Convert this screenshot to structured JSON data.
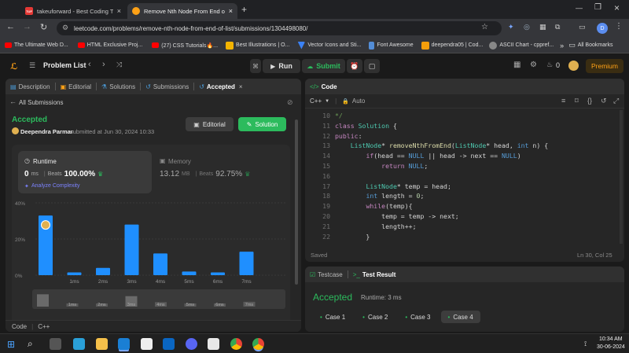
{
  "browser": {
    "tabs": [
      {
        "title": "takeuforward - Best Coding Tut",
        "favicon_color": "#e53935",
        "favicon_text": "TUF"
      },
      {
        "title": "Remove Nth Node From End of",
        "favicon_color": "#ffa116",
        "favicon_text": ""
      }
    ],
    "url": "leetcode.com/problems/remove-nth-node-from-end-of-list/submissions/1304498080/",
    "bookmarks": [
      {
        "label": "The Ultimate Web D...",
        "color": "#ff0000"
      },
      {
        "label": "HTML Exclusive Proj...",
        "color": "#ff0000"
      },
      {
        "label": "(27) CSS Tutorials🔥...",
        "color": "#ff0000"
      },
      {
        "label": "Best Illustrations | O...",
        "color": "#f4b400"
      },
      {
        "label": "Vector Icons and Sti...",
        "color": "#3b82f6"
      },
      {
        "label": "Font Awesome",
        "color": "#538dd7"
      },
      {
        "label": "deependra05 | Cod...",
        "color": "#f59e0b"
      },
      {
        "label": "ASCII Chart - cppref...",
        "color": "#888888"
      }
    ],
    "all_bookmarks": "All Bookmarks",
    "profile_initial": "D"
  },
  "nav": {
    "problem_list": "Problem List",
    "run": "Run",
    "submit": "Submit",
    "streak": "0",
    "premium": "Premium"
  },
  "left": {
    "tabs": {
      "description": "Description",
      "editorial": "Editorial",
      "solutions": "Solutions",
      "submissions": "Submissions",
      "accepted": "Accepted"
    },
    "all_submissions": "All Submissions",
    "status": "Accepted",
    "user": "Deependra Parmar",
    "submitted": "submitted at Jun 30, 2024 10:33",
    "editorial_btn": "Editorial",
    "solution_btn": "Solution",
    "runtime": {
      "label": "Runtime",
      "value": "0",
      "unit": "ms",
      "beats_label": "Beats",
      "beats": "100.00%",
      "analyze": "Analyze Complexity"
    },
    "memory": {
      "label": "Memory",
      "value": "13.12",
      "unit": "MB",
      "beats_label": "Beats",
      "beats": "92.75%"
    },
    "footer": {
      "label": "Code",
      "lang": "C++"
    }
  },
  "chart_data": {
    "type": "bar",
    "ylim": [
      0,
      40
    ],
    "yticks": [
      "40%",
      "20%",
      "0%"
    ],
    "values": [
      33,
      1.5,
      4,
      28,
      12,
      2,
      1.5,
      13
    ],
    "xlabels": [
      "",
      "1ms",
      "2ms",
      "3ms",
      "4ms",
      "5ms",
      "6ms",
      "7ms"
    ],
    "highlight_index": 0,
    "overview_labels": [
      "",
      "1ms",
      "2ms",
      "3ms",
      "4ms",
      "5ms",
      "6ms",
      "7ms"
    ]
  },
  "editor": {
    "title": "Code",
    "lang": "C++",
    "mode": "Auto",
    "saved": "Saved",
    "position": "Ln 30, Col 25",
    "lines": [
      {
        "n": "10",
        "html": "<span class=\"cm\">*/</span>"
      },
      {
        "n": "11",
        "html": "<span class=\"kw\">class</span> <span class=\"ty\">Solution</span> {"
      },
      {
        "n": "12",
        "html": "<span class=\"kw\">public</span>:"
      },
      {
        "n": "13",
        "html": "    <span class=\"ty\">ListNode</span>* <span class=\"fn\">removeNthFromEnd</span>(<span class=\"ty\">ListNode</span>* head, <span class=\"pl\">int</span> n) {"
      },
      {
        "n": "14",
        "html": "        <span class=\"kw\">if</span>(head == <span class=\"pl\">NULL</span> || head -> next == <span class=\"pl\">NULL</span>)"
      },
      {
        "n": "15",
        "html": "            <span class=\"kw\">return</span> <span class=\"pl\">NULL</span>;"
      },
      {
        "n": "16",
        "html": ""
      },
      {
        "n": "17",
        "html": "        <span class=\"ty\">ListNode</span>* temp = head;"
      },
      {
        "n": "18",
        "html": "        <span class=\"pl\">int</span> length = <span class=\"nu\">0</span>;"
      },
      {
        "n": "19",
        "html": "        <span class=\"kw\">while</span>(temp){"
      },
      {
        "n": "20",
        "html": "            temp = temp -> next;"
      },
      {
        "n": "21",
        "html": "            length++;"
      },
      {
        "n": "22",
        "html": "        }"
      }
    ]
  },
  "result": {
    "testcase_tab": "Testcase",
    "result_tab": "Test Result",
    "status": "Accepted",
    "runtime": "Runtime: 3 ms",
    "cases": [
      "Case 1",
      "Case 2",
      "Case 3",
      "Case 4"
    ],
    "active_case": 3
  },
  "taskbar": {
    "time": "10:34 AM",
    "date": "30-06-2024"
  }
}
